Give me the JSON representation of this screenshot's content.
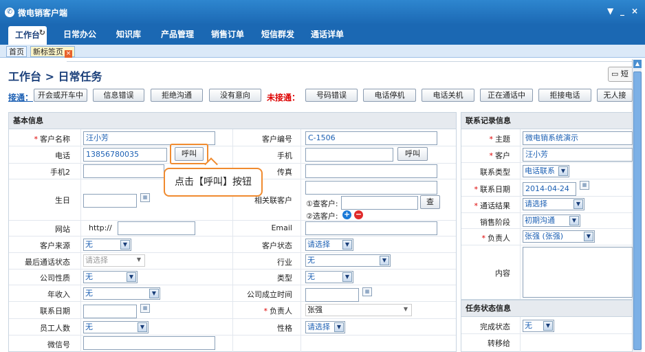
{
  "window": {
    "title": "微电销客户端",
    "controls": [
      "▼",
      "_",
      "×"
    ]
  },
  "menu": [
    "工作台",
    "日常办公",
    "知识库",
    "产品管理",
    "销售订单",
    "短信群发",
    "通话详单"
  ],
  "tabs": {
    "home": "首页",
    "new_tab": "新标签页",
    "close": "×"
  },
  "breadcrumb": "工作台 > 日常任务",
  "sms_button": "短",
  "status": {
    "connected_label": "接通：",
    "connected": [
      "开会或开车中",
      "信息错误",
      "拒绝沟通",
      "没有意向"
    ],
    "unconnected_label": "未接通：",
    "unconnected": [
      "号码错误",
      "电话停机",
      "电话关机",
      "正在通话中",
      "拒接电话",
      "无人接"
    ]
  },
  "basic": {
    "title": "基本信息",
    "customer_name": {
      "label": "客户名称",
      "value": "汪小芳"
    },
    "customer_no": {
      "label": "客户编号",
      "value": "C-1506"
    },
    "phone": {
      "label": "电话",
      "value": "13856780035"
    },
    "mobile": {
      "label": "手机",
      "value": ""
    },
    "call_label": "呼叫",
    "mobile2": {
      "label": "手机2",
      "value": ""
    },
    "fax": {
      "label": "传真",
      "value": ""
    },
    "birthday": {
      "label": "生日",
      "value": ""
    },
    "related": {
      "label": "相关联客户",
      "search_label": "①查客户:",
      "search_btn": "查",
      "select_label": "②选客户:"
    },
    "website": {
      "label": "网站",
      "prefix": "http://",
      "value": ""
    },
    "email": {
      "label": "Email",
      "value": ""
    },
    "source": {
      "label": "客户来源",
      "value": "无"
    },
    "customer_status": {
      "label": "客户状态",
      "value": "请选择"
    },
    "last_call_status": {
      "label": "最后通话状态",
      "value": "请选择"
    },
    "industry": {
      "label": "行业",
      "value": "无"
    },
    "company_nature": {
      "label": "公司性质",
      "value": "无"
    },
    "category": {
      "label": "类型",
      "value": "无"
    },
    "annual_income": {
      "label": "年收入",
      "value": "无"
    },
    "founded": {
      "label": "公司成立时间",
      "value": ""
    },
    "contact_date": {
      "label": "联系日期",
      "value": ""
    },
    "owner": {
      "label": "负责人",
      "value": "张强"
    },
    "staff_count": {
      "label": "员工人数",
      "value": "无"
    },
    "personality": {
      "label": "性格",
      "value": "请选择"
    },
    "wechat": {
      "label": "微信号",
      "value": ""
    }
  },
  "callout": "点击【呼叫】按钮",
  "contact": {
    "title": "联系记录信息",
    "subject": {
      "label": "主题",
      "value": "微电销系统演示"
    },
    "customer": {
      "label": "客户",
      "value": "汪小芳"
    },
    "type": {
      "label": "联系类型",
      "value": "电话联系"
    },
    "date": {
      "label": "联系日期",
      "value": "2014-04-24"
    },
    "result": {
      "label": "通话结果",
      "value": "请选择"
    },
    "stage": {
      "label": "销售阶段",
      "value": "初期沟通"
    },
    "owner": {
      "label": "负责人",
      "value": "张强 (张强)"
    },
    "content": {
      "label": "内容",
      "value": ""
    }
  },
  "task": {
    "title": "任务状态信息",
    "done": {
      "label": "完成状态",
      "value": "无"
    },
    "transfer": {
      "label": "转移给",
      "value": ""
    }
  }
}
